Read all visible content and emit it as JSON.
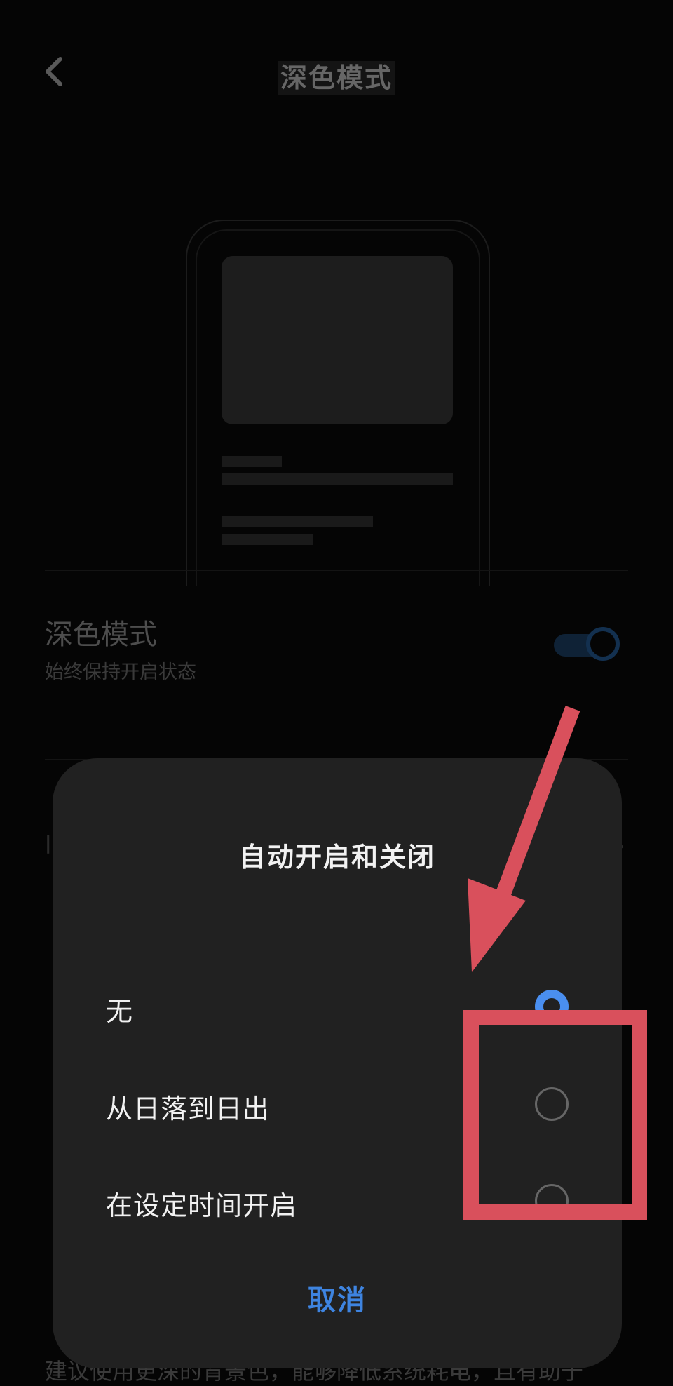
{
  "header": {
    "title": "深色模式",
    "back_icon": "chevron-left-icon"
  },
  "preview": {
    "icon": "phone-preview-illustration"
  },
  "dark_mode_row": {
    "label": "深色模式",
    "subtitle": "始终保持开启状态",
    "toggle_on": true
  },
  "background_text": {
    "bottom": "建议使用更深的背景色，能够降低系统耗电，且有助于"
  },
  "dialog": {
    "title": "自动开启和关闭",
    "options": [
      {
        "label": "无",
        "selected": true
      },
      {
        "label": "从日落到日出",
        "selected": false
      },
      {
        "label": "在设定时间开启",
        "selected": false
      }
    ],
    "cancel_label": "取消"
  },
  "colors": {
    "accent": "#4a8ff0",
    "annotation": "#d9505c",
    "dialog_bg": "#212121"
  }
}
